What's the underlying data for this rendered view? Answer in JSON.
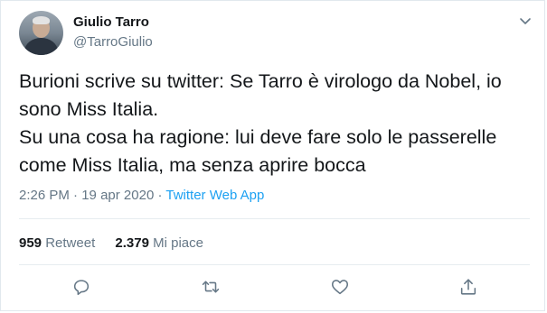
{
  "tweet": {
    "author": {
      "display_name": "Giulio Tarro",
      "handle": "@TarroGiulio"
    },
    "text": "Burioni scrive su twitter: Se Tarro è virologo da Nobel, io sono Miss Italia.\nSu una cosa ha ragione: lui deve fare solo le passerelle come Miss Italia, ma senza aprire bocca",
    "time": "2:26 PM",
    "separator": "·",
    "date": "19 apr 2020",
    "source": "Twitter Web App",
    "stats": {
      "retweets_count": "959",
      "retweets_label": "Retweet",
      "likes_count": "2.379",
      "likes_label": "Mi piace"
    }
  },
  "icons": {
    "menu": "chevron-down-icon",
    "reply": "reply-icon",
    "retweet": "retweet-icon",
    "like": "heart-icon",
    "share": "share-icon"
  },
  "colors": {
    "link": "#1da1f2",
    "secondary_text": "#657786",
    "primary_text": "#14171a",
    "border": "#e6ecf0"
  }
}
